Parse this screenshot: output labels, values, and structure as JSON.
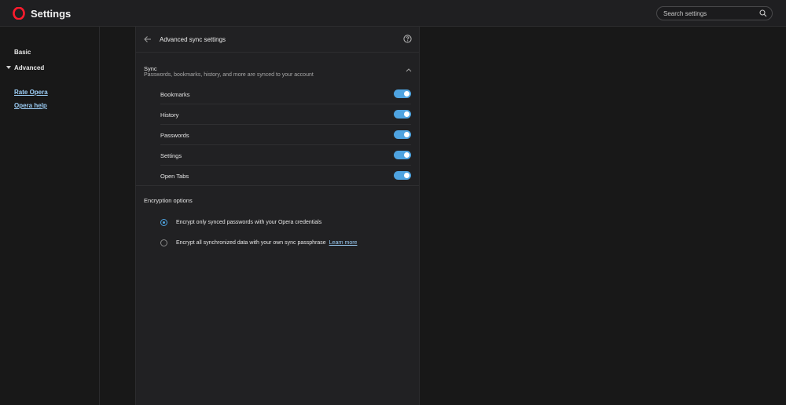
{
  "header": {
    "title": "Settings",
    "logo_icon": "opera-logo-icon",
    "search_placeholder": "Search settings",
    "search_value": ""
  },
  "sidebar": {
    "items": [
      {
        "label": "Basic"
      },
      {
        "label": "Advanced",
        "expanded": true
      }
    ],
    "links": [
      {
        "label": "Rate Opera"
      },
      {
        "label": "Opera help"
      }
    ]
  },
  "panel": {
    "title": "Advanced sync settings",
    "sync": {
      "title": "Sync",
      "description": "Passwords, bookmarks, history, and more are synced to your account",
      "items": [
        {
          "label": "Bookmarks",
          "enabled": true
        },
        {
          "label": "History",
          "enabled": true
        },
        {
          "label": "Passwords",
          "enabled": true
        },
        {
          "label": "Settings",
          "enabled": true
        },
        {
          "label": "Open Tabs",
          "enabled": true
        }
      ]
    },
    "encryption": {
      "title": "Encryption options",
      "options": [
        {
          "label": "Encrypt only synced passwords with your Opera credentials",
          "selected": true
        },
        {
          "label": "Encrypt all synchronized data with your own sync passphrase",
          "selected": false,
          "link": "Learn more"
        }
      ]
    }
  },
  "colors": {
    "accent": "#4ea3e0",
    "brand": "#ff1b2d",
    "link": "#9ccdf5",
    "background": "#181818",
    "panel": "#212123"
  }
}
